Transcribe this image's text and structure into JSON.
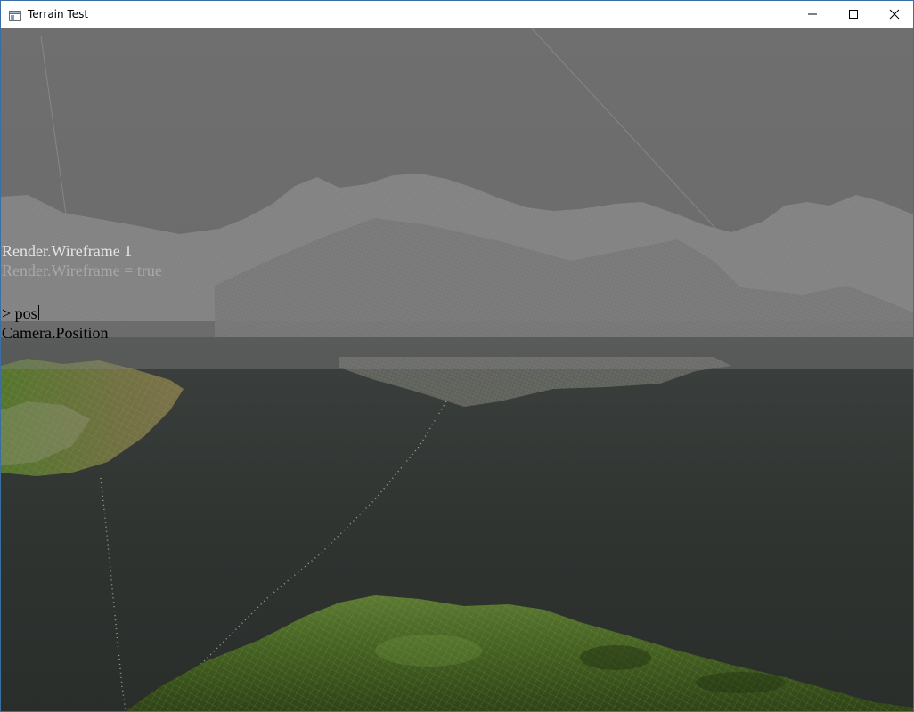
{
  "window": {
    "title": "Terrain Test"
  },
  "titlebar_icons": {
    "app": "window-app-icon",
    "minimize": "minimize-icon",
    "maximize": "maximize-icon",
    "close": "close-icon"
  },
  "console": {
    "history": [
      {
        "text": "Render.Wireframe 1",
        "kind": "command"
      },
      {
        "text": "Render.Wireframe = true",
        "kind": "result"
      }
    ],
    "prompt": "> ",
    "input_value": "pos",
    "suggestion": "Camera.Position"
  },
  "colors": {
    "sky": "#5f5f5f",
    "water": "#2f3431",
    "terrain_green": "#4a6b2a",
    "mountain_haze": "#7d7d7d",
    "console_overlay": "#808080"
  }
}
